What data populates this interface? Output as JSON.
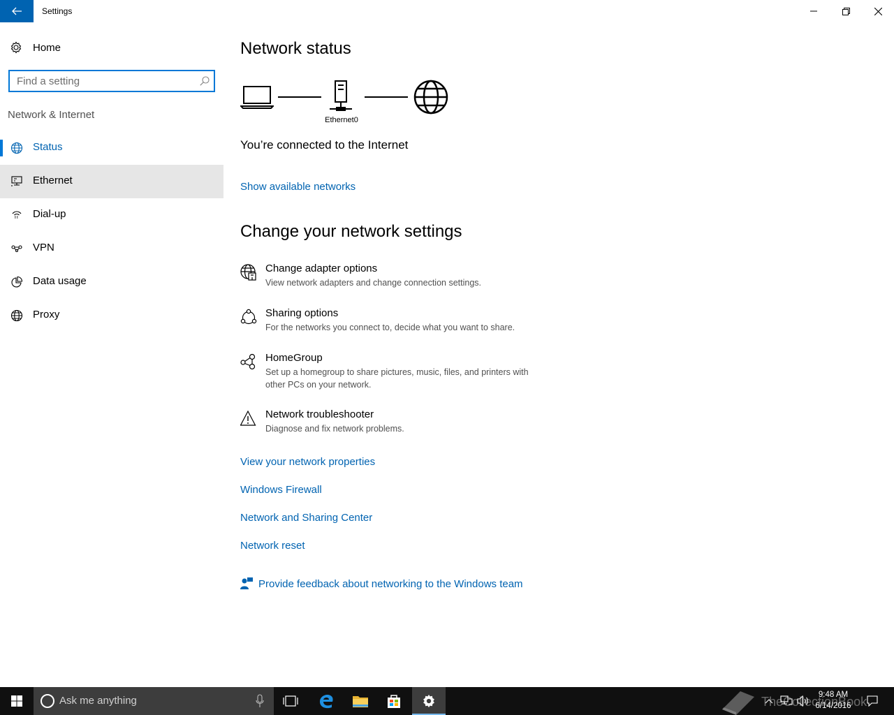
{
  "window": {
    "title": "Settings"
  },
  "sidebar": {
    "home_label": "Home",
    "search_placeholder": "Find a setting",
    "section_label": "Network & Internet",
    "items": [
      {
        "label": "Status",
        "icon": "globe-icon",
        "state": "active"
      },
      {
        "label": "Ethernet",
        "icon": "ethernet-icon",
        "state": "hover"
      },
      {
        "label": "Dial-up",
        "icon": "dialup-icon"
      },
      {
        "label": "VPN",
        "icon": "vpn-icon"
      },
      {
        "label": "Data usage",
        "icon": "pie-chart-icon"
      },
      {
        "label": "Proxy",
        "icon": "globe-icon"
      }
    ]
  },
  "main": {
    "status_heading": "Network status",
    "diagram": {
      "adapter_label": "Ethernet0"
    },
    "connected_text": "You’re connected to the Internet",
    "show_networks_link": "Show available networks",
    "change_heading": "Change your network settings",
    "options": [
      {
        "title": "Change adapter options",
        "desc": "View network adapters and change connection settings.",
        "icon": "adapter-globe-icon"
      },
      {
        "title": "Sharing options",
        "desc": "For the networks you connect to, decide what you want to share.",
        "icon": "sharing-icon"
      },
      {
        "title": "HomeGroup",
        "desc": "Set up a homegroup to share pictures, music, files, and printers with other PCs on your network.",
        "icon": "homegroup-icon"
      },
      {
        "title": "Network troubleshooter",
        "desc": "Diagnose and fix network problems.",
        "icon": "warning-icon"
      }
    ],
    "links": [
      "View your network properties",
      "Windows Firewall",
      "Network and Sharing Center",
      "Network reset"
    ],
    "feedback_link": "Provide feedback about networking to the Windows team"
  },
  "taskbar": {
    "search_placeholder": "Ask me anything",
    "time": "9:48 AM",
    "date": "6/14/2016",
    "watermark": "TheCollectionBook"
  },
  "colors": {
    "accent": "#0078d7",
    "link": "#0063b1",
    "hover_bg": "#e6e6e6",
    "taskbar": "#101010"
  }
}
